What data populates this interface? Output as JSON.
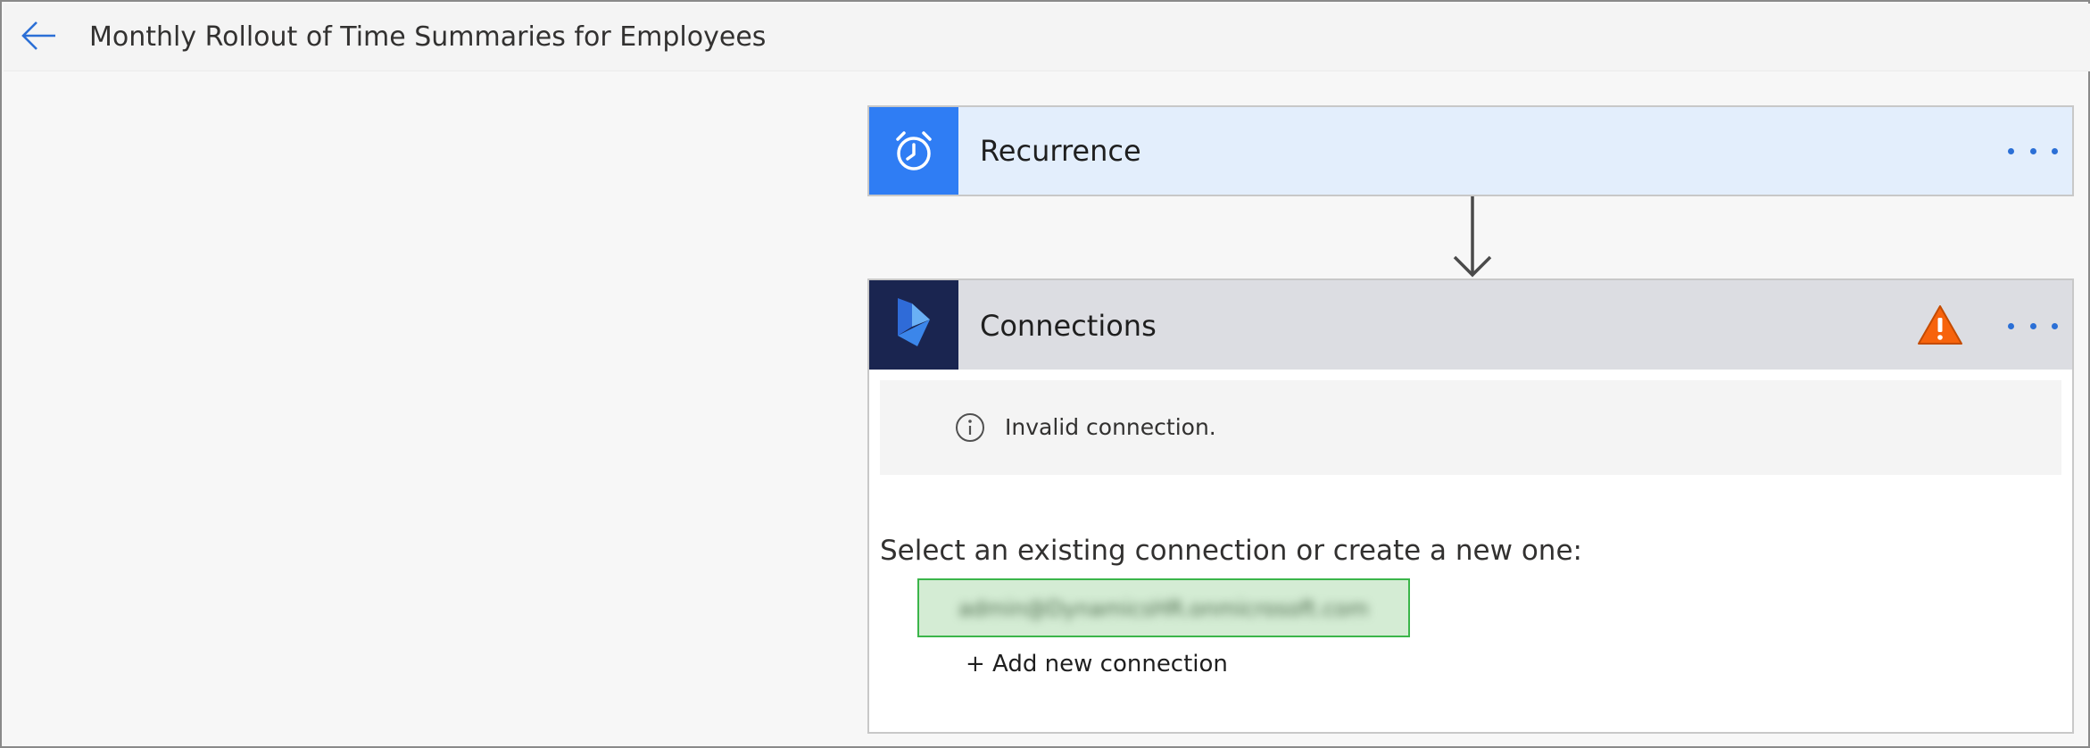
{
  "header": {
    "title": "Monthly Rollout of Time Summaries for Employees",
    "back_icon": "arrow-left-icon"
  },
  "colors": {
    "accent": "#2f7df4",
    "dynamics_navy": "#1a2550",
    "recurrence_bg": "#e3eefc",
    "connections_header_bg": "#dcdde2",
    "warning": "#f7630c",
    "selected_border": "#3bb54a",
    "selected_bg": "#d4ecd4"
  },
  "flow": {
    "recurrence": {
      "title": "Recurrence",
      "icon": "alarm-clock-icon",
      "more_icon": "ellipsis-icon"
    },
    "connections": {
      "title": "Connections",
      "icon": "dynamics-365-icon",
      "status_icon": "warning-triangle-icon",
      "more_icon": "ellipsis-icon",
      "info_icon": "info-circle-icon",
      "info_message": "Invalid connection.",
      "select_prompt": "Select an existing connection or create a new one:",
      "selected_connection": "admin@DynamicsHR.onmicrosoft.com",
      "add_new_label": "+ Add new connection"
    }
  }
}
